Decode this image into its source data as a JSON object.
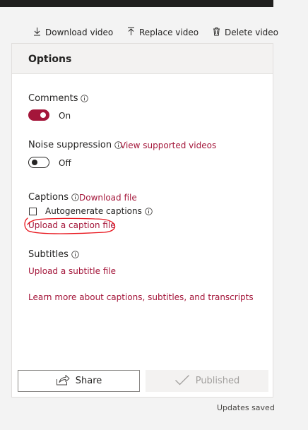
{
  "toolbar": {
    "download_label": "Download video",
    "replace_label": "Replace video",
    "delete_label": "Delete video"
  },
  "options": {
    "title": "Options",
    "comments": {
      "label": "Comments",
      "state": "On"
    },
    "noise": {
      "label": "Noise suppression",
      "link": "View supported videos",
      "state": "Off"
    },
    "captions": {
      "label": "Captions",
      "download_link": "Download file",
      "autogen_label": "Autogenerate captions",
      "upload_link": "Upload a caption file"
    },
    "subtitles": {
      "label": "Subtitles",
      "upload_link": "Upload a subtitle file"
    },
    "learn_more": "Learn more about captions, subtitles, and transcripts"
  },
  "actions": {
    "share_label": "Share",
    "published_label": "Published"
  },
  "status": "Updates saved",
  "colors": {
    "accent": "#a4163a",
    "annotation": "#e8141c"
  }
}
